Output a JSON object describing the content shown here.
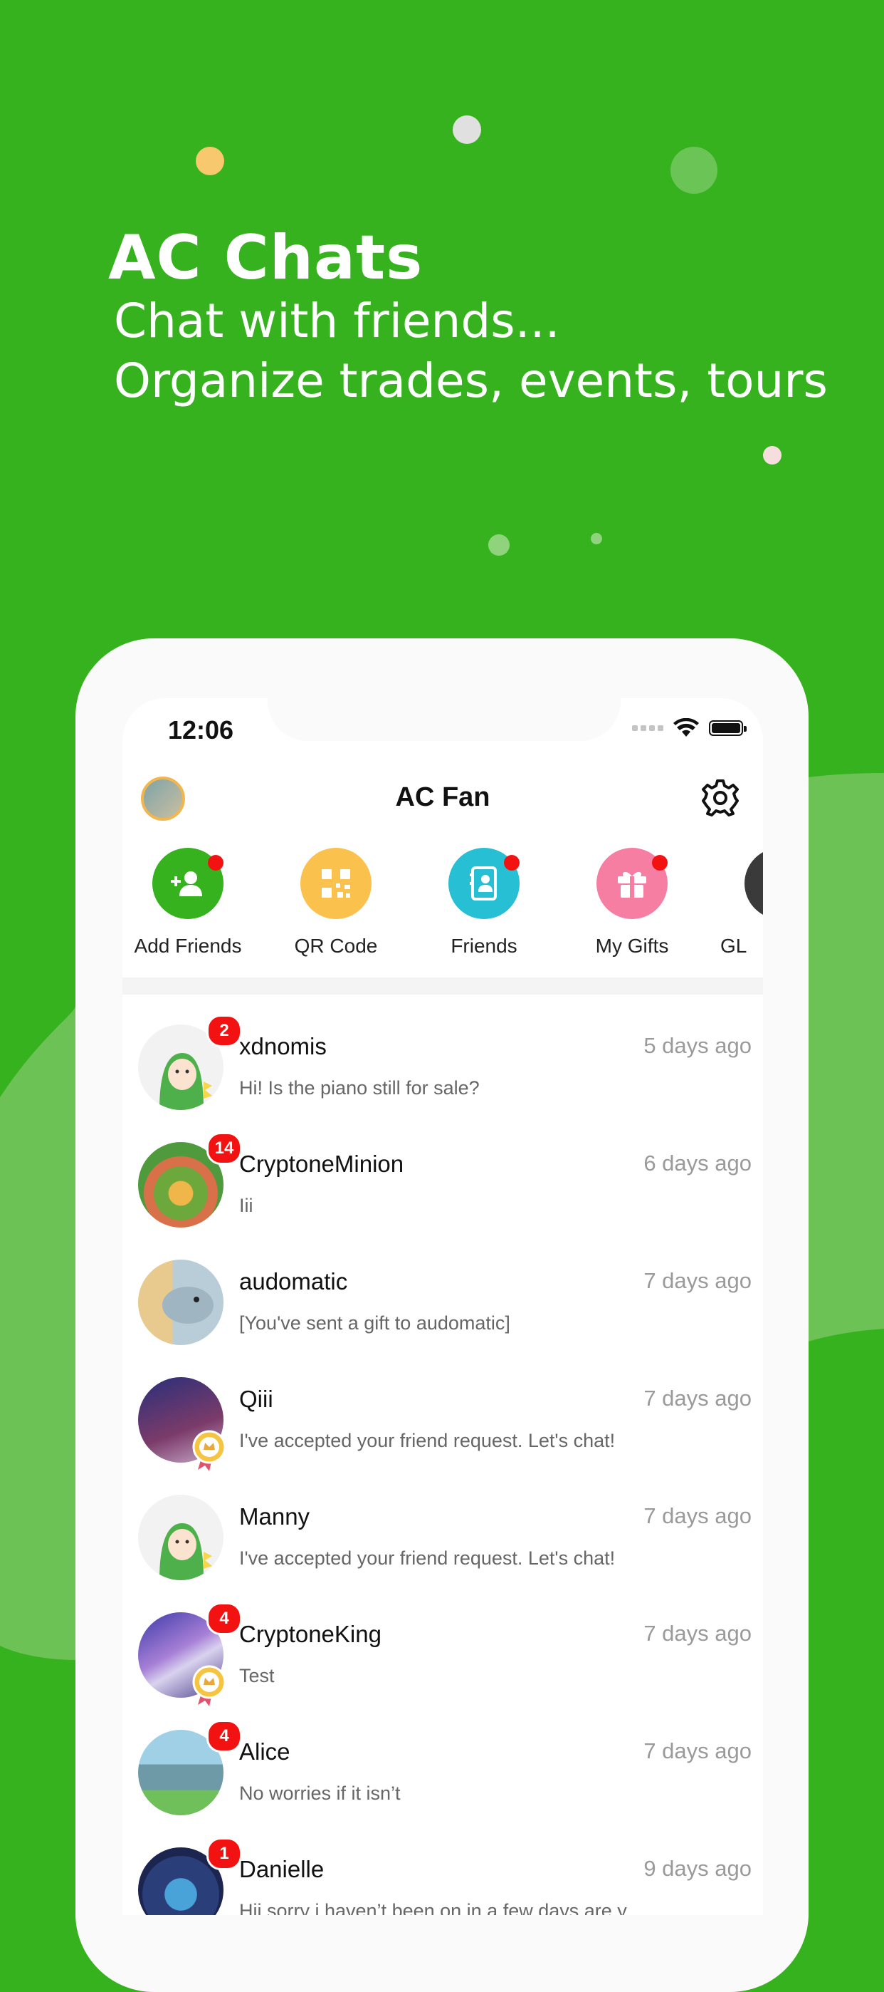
{
  "hero": {
    "title": "AC Chats",
    "subtitle_line1": "Chat with friends...",
    "subtitle_line2": "Organize trades, events, tours"
  },
  "colors": {
    "brand_green": "#35b21d",
    "badge_red": "#f31212",
    "add_friends": "#35b21d",
    "qr_code": "#fbc14d",
    "friends": "#27bfd4",
    "my_gifts": "#f57ea2"
  },
  "status_bar": {
    "time": "12:06"
  },
  "header": {
    "title": "AC Fan"
  },
  "shortcuts": [
    {
      "label": "Add Friends",
      "icon": "add-user-icon",
      "has_dot": true
    },
    {
      "label": "QR Code",
      "icon": "qr-code-icon",
      "has_dot": false
    },
    {
      "label": "Friends",
      "icon": "contacts-icon",
      "has_dot": true
    },
    {
      "label": "My Gifts",
      "icon": "gift-icon",
      "has_dot": true
    },
    {
      "label": "GL",
      "icon": "more-icon",
      "has_dot": false
    }
  ],
  "chats": [
    {
      "name": "xdnomis",
      "time": "5 days ago",
      "preview": "Hi! Is the piano still for sale?",
      "badge": "2"
    },
    {
      "name": "CryptoneMinion",
      "time": "6 days ago",
      "preview": "Iii",
      "badge": "14"
    },
    {
      "name": "audomatic",
      "time": "7 days ago",
      "preview": "[You've sent a gift to audomatic]",
      "badge": ""
    },
    {
      "name": "Qiii",
      "time": "7 days ago",
      "preview": "I've accepted your friend request. Let's chat!",
      "badge": ""
    },
    {
      "name": "Manny",
      "time": "7 days ago",
      "preview": "I've accepted your friend request. Let's chat!",
      "badge": ""
    },
    {
      "name": "CryptoneKing",
      "time": "7 days ago",
      "preview": "Test",
      "badge": "4"
    },
    {
      "name": "Alice",
      "time": "7 days ago",
      "preview": "No worries if it isn’t",
      "badge": "4"
    },
    {
      "name": "Danielle",
      "time": "9 days ago",
      "preview": "Hii sorry i haven’t been on in a few days are y",
      "badge": "1"
    }
  ]
}
